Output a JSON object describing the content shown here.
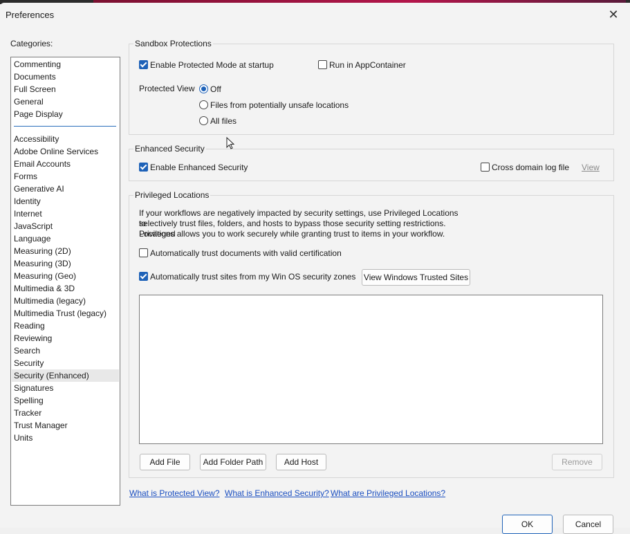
{
  "window": {
    "title": "Preferences"
  },
  "categories": {
    "label": "Categories:",
    "top_items": [
      "Commenting",
      "Documents",
      "Full Screen",
      "General",
      "Page Display"
    ],
    "items": [
      "Accessibility",
      "Adobe Online Services",
      "Email Accounts",
      "Forms",
      "Generative AI",
      "Identity",
      "Internet",
      "JavaScript",
      "Language",
      "Measuring (2D)",
      "Measuring (3D)",
      "Measuring (Geo)",
      "Multimedia & 3D",
      "Multimedia (legacy)",
      "Multimedia Trust (legacy)",
      "Reading",
      "Reviewing",
      "Search",
      "Security",
      "Security (Enhanced)",
      "Signatures",
      "Spelling",
      "Tracker",
      "Trust Manager",
      "Units"
    ],
    "selected": "Security (Enhanced)"
  },
  "sandbox": {
    "title": "Sandbox Protections",
    "protected_mode": {
      "label": "Enable Protected Mode at startup",
      "checked": true
    },
    "app_container": {
      "label": "Run in AppContainer",
      "checked": false
    },
    "protected_view": {
      "label": "Protected View",
      "options": [
        "Off",
        "Files from potentially unsafe locations",
        "All files"
      ],
      "selected": "Off"
    }
  },
  "enhanced": {
    "title": "Enhanced Security",
    "enable": {
      "label": "Enable Enhanced Security",
      "checked": true
    },
    "cross_domain": {
      "label": "Cross domain log file",
      "checked": false
    },
    "view_link": "View"
  },
  "privileged": {
    "title": "Privileged Locations",
    "description_lines": [
      "If your workflows are negatively impacted by security settings, use Privileged Locations to",
      "selectively trust files, folders, and hosts to bypass those security setting restrictions. Privileged",
      "Locations allows you to work securely while granting trust to items in your workflow."
    ],
    "auto_cert": {
      "label": "Automatically trust documents with valid certification",
      "checked": false
    },
    "auto_sites": {
      "label": "Automatically trust sites from my Win OS security zones",
      "checked": true
    },
    "view_sites_button": "View Windows Trusted Sites",
    "buttons": {
      "add_file": "Add File",
      "add_folder": "Add Folder Path",
      "add_host": "Add Host",
      "remove": "Remove"
    }
  },
  "links": {
    "protected_view": "What is Protected View?",
    "enhanced_security": "What is Enhanced Security?",
    "privileged_locations": "What are Privileged Locations?"
  },
  "footer": {
    "ok": "OK",
    "cancel": "Cancel"
  },
  "colors": {
    "accent": "#1e62b8",
    "link": "#1a4ec0"
  }
}
